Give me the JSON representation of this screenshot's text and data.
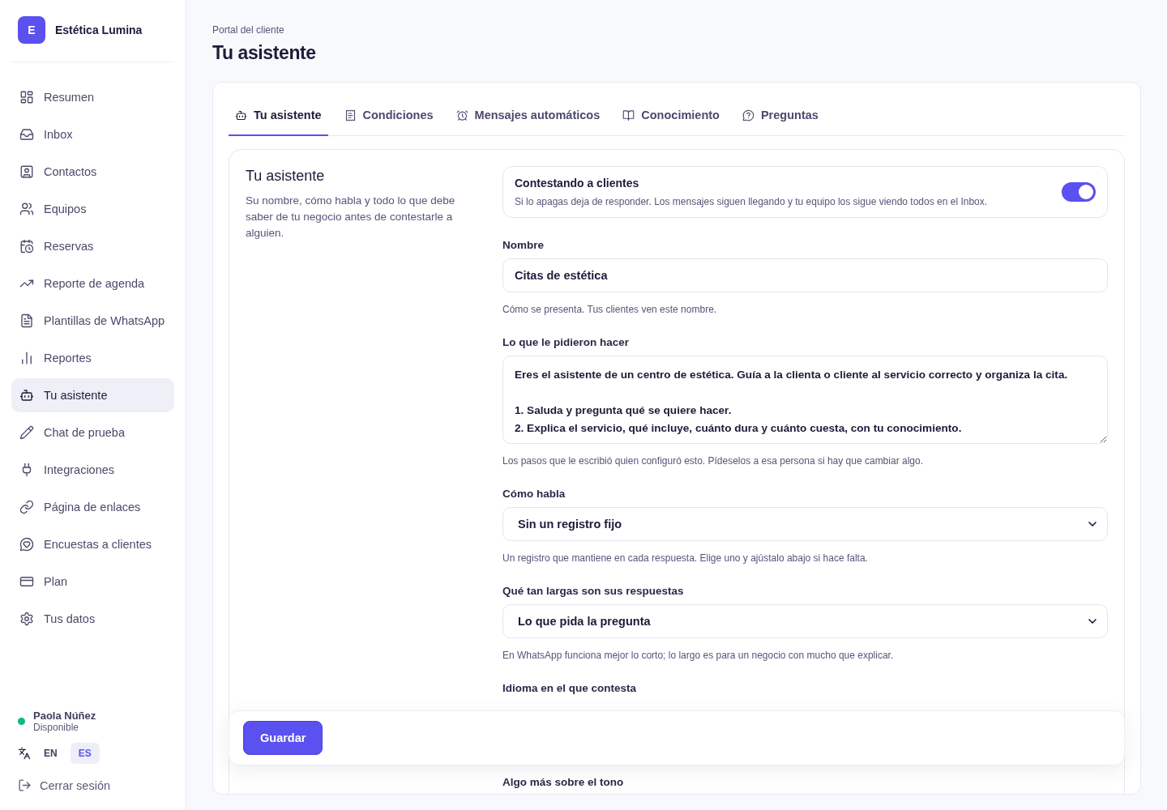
{
  "brand": {
    "initial": "E",
    "name": "Estética Lumina"
  },
  "sidebar": {
    "items": [
      {
        "label": "Resumen",
        "selected": false
      },
      {
        "label": "Inbox",
        "selected": false
      },
      {
        "label": "Contactos",
        "selected": false
      },
      {
        "label": "Equipos",
        "selected": false
      },
      {
        "label": "Reservas",
        "selected": false
      },
      {
        "label": "Reporte de agenda",
        "selected": false
      },
      {
        "label": "Plantillas de WhatsApp",
        "selected": false
      },
      {
        "label": "Reportes",
        "selected": false
      },
      {
        "label": "Tu asistente",
        "selected": true
      },
      {
        "label": "Chat de prueba",
        "selected": false
      },
      {
        "label": "Integraciones",
        "selected": false
      },
      {
        "label": "Página de enlaces",
        "selected": false
      },
      {
        "label": "Encuestas a clientes",
        "selected": false
      },
      {
        "label": "Plan",
        "selected": false
      },
      {
        "label": "Tus datos",
        "selected": false
      }
    ]
  },
  "user": {
    "name": "Paola Núñez",
    "status": "Disponible",
    "color": "#10b981"
  },
  "languages": [
    {
      "label": "EN",
      "selected": false
    },
    {
      "label": "ES",
      "selected": true
    }
  ],
  "logout": "Cerrar sesión",
  "header": {
    "breadcrumb": "Portal del cliente",
    "title": "Tu asistente"
  },
  "tabs": [
    {
      "label": "Tu asistente",
      "selected": true
    },
    {
      "label": "Condiciones",
      "selected": false
    },
    {
      "label": "Mensajes automáticos",
      "selected": false
    },
    {
      "label": "Conocimiento",
      "selected": false
    },
    {
      "label": "Preguntas",
      "selected": false
    }
  ],
  "section": {
    "title": "Tu asistente",
    "description": "Su nombre, cómo habla y todo lo que debe saber de tu negocio antes de contestarle a alguien."
  },
  "toggle": {
    "title": "Contestando a clientes",
    "description": "Si lo apagas deja de responder. Los mensajes siguen llegando y tu equipo los sigue viendo todos en el Inbox.",
    "on": true
  },
  "fields": [
    {
      "kind": "text",
      "label": "Nombre",
      "value": "Citas de estética",
      "help": "Cómo se presenta. Tus clientes ven este nombre."
    },
    {
      "kind": "textarea",
      "label": "Lo que le pidieron hacer",
      "value": "Eres el asistente de un centro de estética. Guía a la clienta o cliente al servicio correcto y organiza la cita.\n\n1. Saluda y pregunta qué se quiere hacer.\n2. Explica el servicio, qué incluye, cuánto dura y cuánto cuesta, con tu conocimiento.",
      "help": "Los pasos que le escribió quien configuró esto. Pídeselos a esa persona si hay que cambiar algo."
    },
    {
      "kind": "select",
      "label": "Cómo habla",
      "value": "Sin un registro fijo",
      "help": "Un registro que mantiene en cada respuesta. Elige uno y ajústalo abajo si hace falta."
    },
    {
      "kind": "select",
      "label": "Qué tan largas son sus respuestas",
      "value": "Lo que pida la pregunta",
      "help": "En WhatsApp funciona mejor lo corto; lo largo es para un negocio con mucho que explicar."
    },
    {
      "kind": "select",
      "label": "Idioma en el que contesta"
    },
    {
      "kind": "textarea",
      "label": "Algo más sobre el tono"
    }
  ],
  "save_button": "Guardar"
}
